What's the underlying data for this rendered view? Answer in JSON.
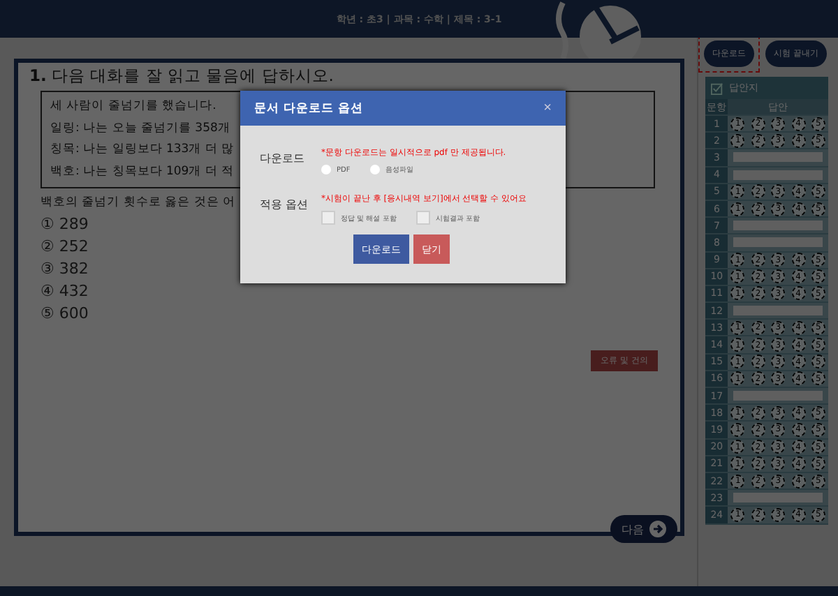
{
  "header": {
    "info": "학년 : 초3 | 과목 : 수학 | 제목 : 3-1"
  },
  "top_buttons": [
    {
      "label": "다운로드",
      "focused": true
    },
    {
      "label": "시험 끝내기",
      "focused": false
    }
  ],
  "question": {
    "number": "1.",
    "prompt": "다음 대화를 잘 읽고 물음에 답하시오.",
    "passage": [
      "세 사람이 줄넘기를 했습니다.",
      "일링: 나는 오늘 줄넘기를 358개",
      "칭목: 나는 일링보다 133개 더 많",
      "백호: 나는 칭목보다 109개 더 적"
    ],
    "ask": "백호의 줄넘기 횟수로 옳은 것은 어",
    "options": [
      "① 289",
      "② 252",
      "③ 382",
      "④ 432",
      "⑤ 600"
    ]
  },
  "report_button": "오류 및 건의",
  "next_button": "다음",
  "answer_sheet": {
    "title": "답안지",
    "columns": [
      "문항",
      "답안"
    ],
    "rows": [
      {
        "number": "1",
        "kind": "choice",
        "choices": [
          "1",
          "2",
          "3",
          "4",
          "5"
        ]
      },
      {
        "number": "2",
        "kind": "choice",
        "choices": [
          "1",
          "2",
          "3",
          "4",
          "5"
        ]
      },
      {
        "number": "3",
        "kind": "text"
      },
      {
        "number": "4",
        "kind": "text"
      },
      {
        "number": "5",
        "kind": "choice",
        "choices": [
          "1",
          "2",
          "3",
          "4",
          "5"
        ]
      },
      {
        "number": "6",
        "kind": "choice",
        "choices": [
          "1",
          "2",
          "3",
          "4",
          "5"
        ]
      },
      {
        "number": "7",
        "kind": "text"
      },
      {
        "number": "8",
        "kind": "text"
      },
      {
        "number": "9",
        "kind": "choice",
        "choices": [
          "1",
          "2",
          "3",
          "4",
          "5"
        ]
      },
      {
        "number": "10",
        "kind": "choice",
        "choices": [
          "1",
          "2",
          "3",
          "4",
          "5"
        ]
      },
      {
        "number": "11",
        "kind": "choice",
        "choices": [
          "1",
          "2",
          "3",
          "4",
          "5"
        ]
      },
      {
        "number": "12",
        "kind": "text"
      },
      {
        "number": "13",
        "kind": "choice",
        "choices": [
          "1",
          "2",
          "3",
          "4",
          "5"
        ]
      },
      {
        "number": "14",
        "kind": "choice",
        "choices": [
          "1",
          "2",
          "3",
          "4",
          "5"
        ]
      },
      {
        "number": "15",
        "kind": "choice",
        "choices": [
          "1",
          "2",
          "3",
          "4",
          "5"
        ]
      },
      {
        "number": "16",
        "kind": "choice",
        "choices": [
          "1",
          "2",
          "3",
          "4",
          "5"
        ]
      },
      {
        "number": "17",
        "kind": "text"
      },
      {
        "number": "18",
        "kind": "choice",
        "choices": [
          "1",
          "2",
          "3",
          "4",
          "5"
        ]
      },
      {
        "number": "19",
        "kind": "choice",
        "choices": [
          "1",
          "2",
          "3",
          "4",
          "5"
        ]
      },
      {
        "number": "20",
        "kind": "choice",
        "choices": [
          "1",
          "2",
          "3",
          "4",
          "5"
        ]
      },
      {
        "number": "21",
        "kind": "choice",
        "choices": [
          "1",
          "2",
          "3",
          "4",
          "5"
        ]
      },
      {
        "number": "22",
        "kind": "choice",
        "choices": [
          "1",
          "2",
          "3",
          "4",
          "5"
        ]
      },
      {
        "number": "23",
        "kind": "text"
      },
      {
        "number": "24",
        "kind": "choice",
        "choices": [
          "1",
          "2",
          "3",
          "4",
          "5"
        ]
      }
    ]
  },
  "dialog": {
    "title": "문서 다운로드 옵션",
    "close": "×",
    "sections": [
      {
        "label": "다운로드",
        "kind": "radio",
        "note": "*문항 다운로드는 일시적으로 pdf 만 제공됩니다.",
        "options": [
          {
            "label": "PDF",
            "selected": false
          },
          {
            "label": "음성파일",
            "selected": false
          }
        ]
      },
      {
        "label": "적용 옵션",
        "kind": "checkbox",
        "note": "*시험이 끝난 후 [응시내역 보기]에서 선택할 수 있어요",
        "options": [
          {
            "label": "정답 및 해설 포함",
            "checked": false
          },
          {
            "label": "시험결과 포함",
            "checked": false
          }
        ]
      }
    ],
    "buttons": [
      {
        "label": "다운로드",
        "kind": "primary"
      },
      {
        "label": "닫기",
        "kind": "cancel"
      }
    ]
  }
}
